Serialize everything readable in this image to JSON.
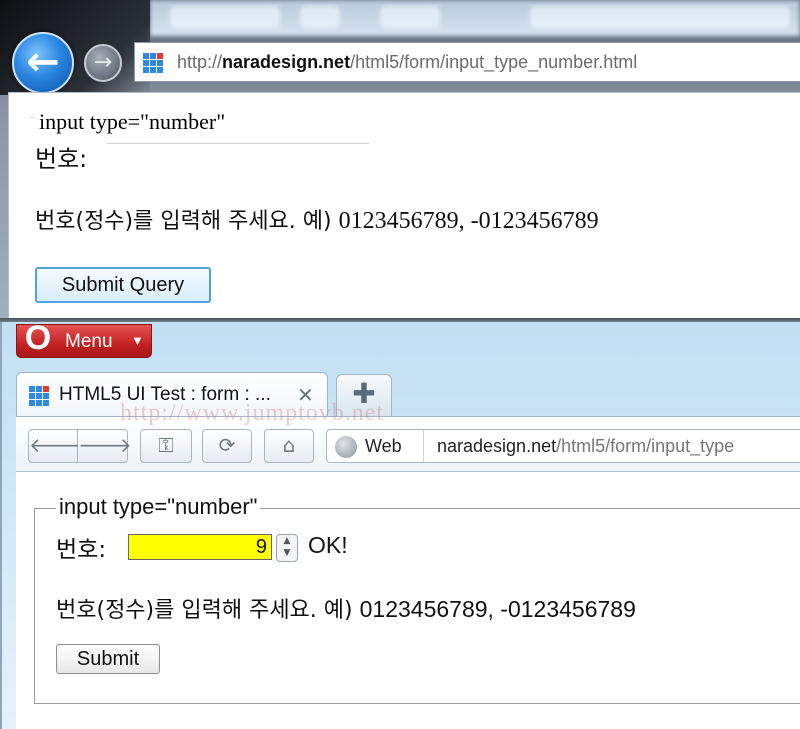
{
  "ie": {
    "back_glyph": "←",
    "forward_glyph": "→",
    "url_prefix": "http://",
    "url_domain": "naradesign.net",
    "url_path": "/html5/form/input_type_number.html",
    "legend": "input type=\"number\"",
    "label": "번호:",
    "input_value": "",
    "help_text": "번호(정수)를 입력해 주세요. 예) ",
    "help_example": "0123456789, -0123456789",
    "submit_label": "Submit Query"
  },
  "opera": {
    "menu_label": "Menu",
    "menu_logo": "O",
    "tab_title": "HTML5 UI Test : form : ...",
    "tab_close": "✕",
    "new_tab": "✚",
    "watermark": "http://www.jumptovb.net",
    "nav": {
      "back": "🡐",
      "forward": "🡒",
      "key": "⚿",
      "reload": "⟳",
      "home": "⌂"
    },
    "web_label": "Web",
    "url_domain": "naradesign.net",
    "url_path": "/html5/form/input_type",
    "legend": "input type=\"number\"",
    "label": "번호:",
    "input_value": "9",
    "validation": "OK!",
    "help_text": "번호(정수)를 입력해 주세요. 예) ",
    "help_example": "0123456789, -0123456789",
    "submit_label": "Submit"
  },
  "colors": {
    "opera_red": "#c42121",
    "input_highlight": "#ffff00",
    "ie_accent": "#2a86e0"
  }
}
